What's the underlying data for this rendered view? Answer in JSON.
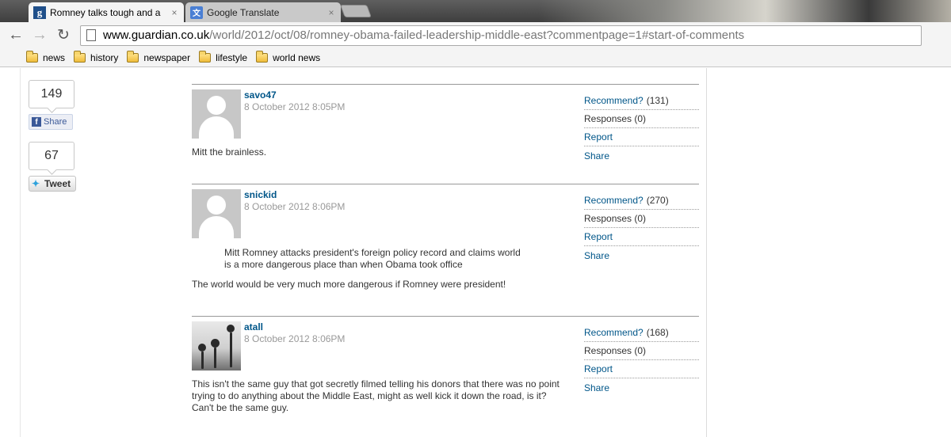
{
  "browser": {
    "tabs": [
      {
        "title": "Romney talks tough and a",
        "close": "×"
      },
      {
        "title": "Google Translate",
        "close": "×"
      }
    ],
    "url": {
      "host": "www.guardian.co.uk",
      "path": "/world/2012/oct/08/romney-obama-failed-leadership-middle-east?commentpage=1#start-of-comments"
    },
    "bookmarks": [
      "news",
      "history",
      "newspaper",
      "lifestyle",
      "world news"
    ]
  },
  "social": {
    "facebook": {
      "count": "149",
      "label": "Share"
    },
    "twitter": {
      "count": "67",
      "label": "Tweet"
    }
  },
  "comments": [
    {
      "username": "savo47",
      "timestamp": "8 October 2012 8:05PM",
      "body": "Mitt the brainless.",
      "recommend_label": "Recommend?",
      "recommend_count": "(131)",
      "responses": "Responses (0)",
      "report": "Report",
      "share": "Share"
    },
    {
      "username": "snickid",
      "timestamp": "8 October 2012 8:06PM",
      "quote": "Mitt Romney attacks president's foreign policy record and claims world is a more dangerous place than when Obama took office",
      "body": "The world would be very much more dangerous if Romney were president!",
      "recommend_label": "Recommend?",
      "recommend_count": "(270)",
      "responses": "Responses (0)",
      "report": "Report",
      "share": "Share"
    },
    {
      "username": "atall",
      "timestamp": "8 October 2012 8:06PM",
      "body": "This isn't the same guy that got secretly filmed telling his donors that there was no point trying to do anything about the Middle East, might as well kick it down the road, is it? Can't be the same guy.",
      "recommend_label": "Recommend?",
      "recommend_count": "(168)",
      "responses": "Responses (0)",
      "report": "Report",
      "share": "Share"
    }
  ]
}
